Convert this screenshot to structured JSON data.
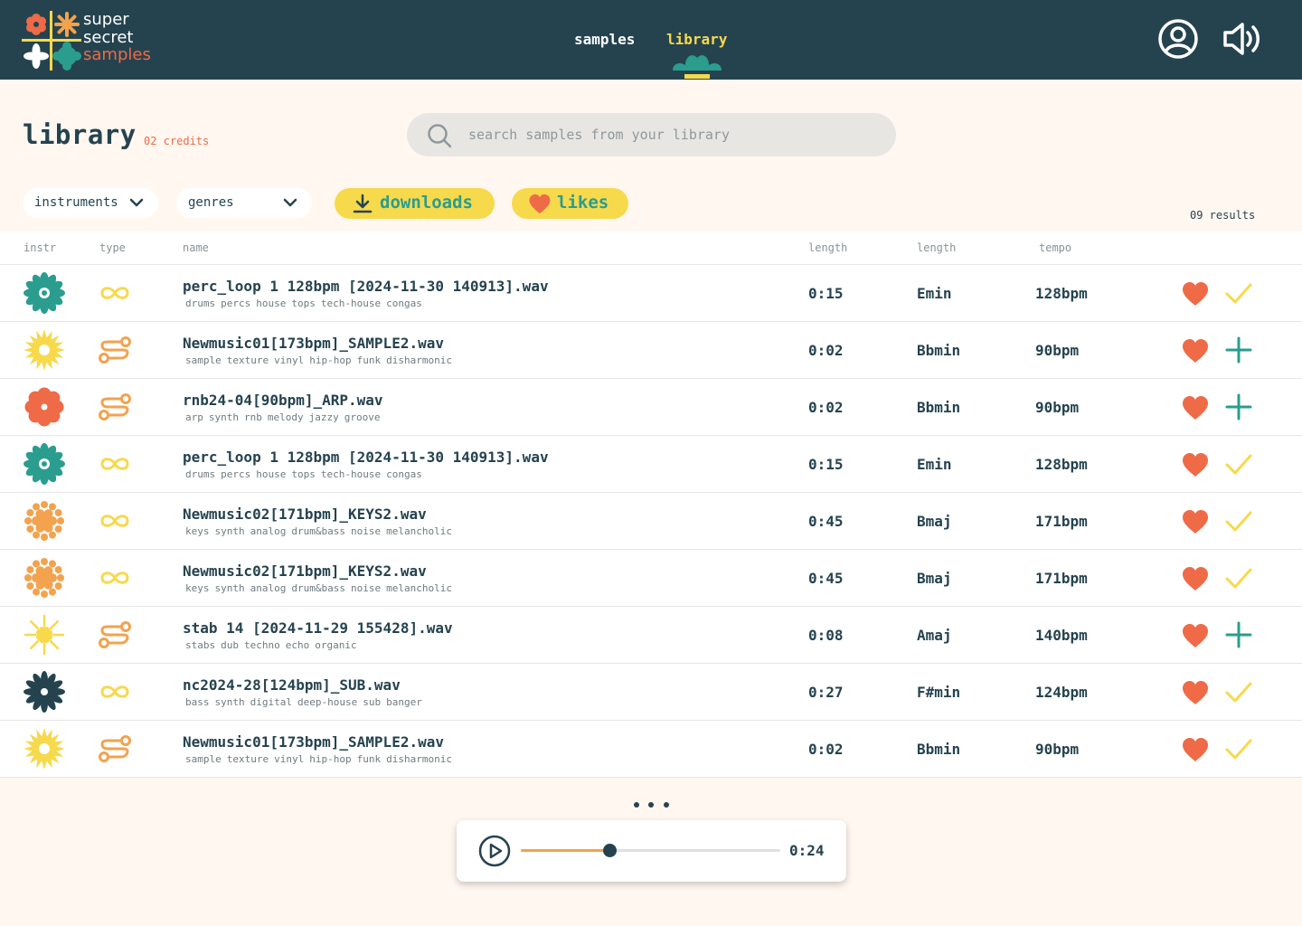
{
  "brand": {
    "line1": "super",
    "line2": "secret",
    "line3": "samples"
  },
  "nav": {
    "samples": "samples",
    "library": "library",
    "active": "library"
  },
  "colors": {
    "header": "#25434f",
    "accent_yellow": "#f7d94c",
    "accent_teal": "#2a9d8f",
    "accent_orange": "#ef6a47",
    "background": "#fff7f0"
  },
  "page": {
    "title": "library",
    "credits": "02 credits"
  },
  "search": {
    "placeholder": "search samples from your library",
    "value": ""
  },
  "filters": {
    "instruments": "instruments",
    "genres": "genres",
    "downloads": "downloads",
    "likes": "likes"
  },
  "results": "09 results",
  "columns": {
    "instr": "instr",
    "type": "type",
    "name": "name",
    "length": "length",
    "key": "length",
    "tempo": "tempo"
  },
  "rows": [
    {
      "instr_icon": "teal-flower",
      "type": "loop",
      "name": "perc_loop 1 128bpm [2024-11-30 140913].wav",
      "tags": [
        "drums",
        "percs",
        "house",
        "tops",
        "tech-house",
        "congas"
      ],
      "length": "0:15",
      "key": "Emin",
      "tempo": "128bpm",
      "status": "downloaded"
    },
    {
      "instr_icon": "yellow-sun",
      "type": "one-shot",
      "name": "Newmusic01[173bpm]_SAMPLE2.wav",
      "tags": [
        "sample",
        "texture",
        "vinyl",
        "hip-hop",
        "funk",
        "disharmonic"
      ],
      "length": "0:02",
      "key": "Bbmin",
      "tempo": "90bpm",
      "status": "add"
    },
    {
      "instr_icon": "red-flower",
      "type": "one-shot",
      "name": "rnb24-04[90bpm]_ARP.wav",
      "tags": [
        "arp",
        "synth",
        "rnb",
        "melody",
        "jazzy",
        "groove"
      ],
      "length": "0:02",
      "key": "Bbmin",
      "tempo": "90bpm",
      "status": "add"
    },
    {
      "instr_icon": "teal-flower",
      "type": "loop",
      "name": "perc_loop 1 128bpm [2024-11-30 140913].wav",
      "tags": [
        "drums",
        "percs",
        "house",
        "tops",
        "tech-house",
        "congas"
      ],
      "length": "0:15",
      "key": "Emin",
      "tempo": "128bpm",
      "status": "downloaded"
    },
    {
      "instr_icon": "orange-dots",
      "type": "loop",
      "name": "Newmusic02[171bpm]_KEYS2.wav",
      "tags": [
        "keys",
        "synth",
        "analog",
        "drum&bass",
        "noise",
        "melancholic"
      ],
      "length": "0:45",
      "key": "Bmaj",
      "tempo": "171bpm",
      "status": "downloaded"
    },
    {
      "instr_icon": "orange-dots",
      "type": "loop",
      "name": "Newmusic02[171bpm]_KEYS2.wav",
      "tags": [
        "keys",
        "synth",
        "analog",
        "drum&bass",
        "noise",
        "melancholic"
      ],
      "length": "0:45",
      "key": "Bmaj",
      "tempo": "171bpm",
      "status": "downloaded"
    },
    {
      "instr_icon": "yellow-spark",
      "type": "one-shot",
      "name": "stab 14 [2024-11-29 155428].wav",
      "tags": [
        "stabs",
        "dub",
        "techno",
        "echo",
        "organic"
      ],
      "length": "0:08",
      "key": "Amaj",
      "tempo": "140bpm",
      "status": "add"
    },
    {
      "instr_icon": "navy-flower",
      "type": "loop",
      "name": "nc2024-28[124bpm]_SUB.wav",
      "tags": [
        "bass",
        "synth",
        "digital",
        "deep-house",
        "sub",
        "banger"
      ],
      "length": "0:27",
      "key": "F#min",
      "tempo": "124bpm",
      "status": "downloaded"
    },
    {
      "instr_icon": "yellow-sun",
      "type": "one-shot",
      "name": "Newmusic01[173bpm]_SAMPLE2.wav",
      "tags": [
        "sample",
        "texture",
        "vinyl",
        "hip-hop",
        "funk",
        "disharmonic"
      ],
      "length": "0:02",
      "key": "Bbmin",
      "tempo": "90bpm",
      "status": "downloaded"
    }
  ],
  "player": {
    "time": "0:24",
    "progress": 0.34
  }
}
